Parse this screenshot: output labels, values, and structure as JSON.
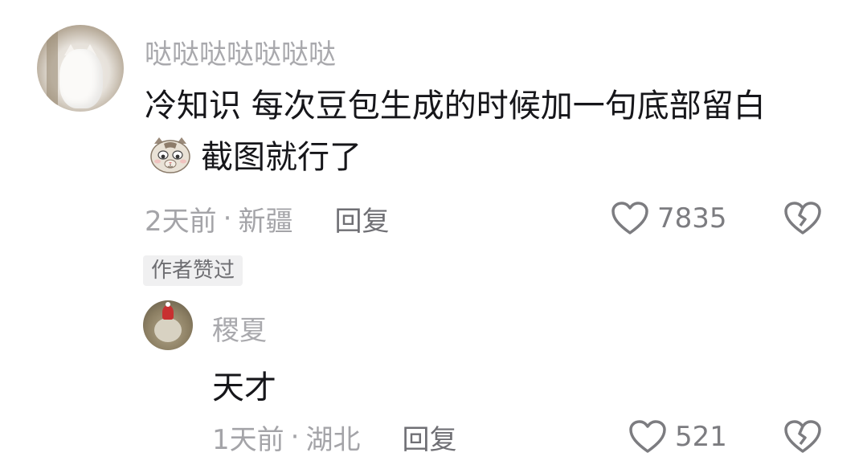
{
  "comment": {
    "username": "哒哒哒哒哒哒哒",
    "text_before_emoji": "冷知识 每次豆包生成的时候加一句底部留白",
    "emoji": "cat-face-emoji",
    "text_after_emoji": "截图就行了",
    "time": "2天前",
    "separator": "·",
    "location": "新疆",
    "reply_label": "回复",
    "like_count": "7835",
    "author_liked_badge": "作者赞过"
  },
  "reply": {
    "username": "稷夏",
    "text": "天才",
    "time": "1天前",
    "separator": "·",
    "location": "湖北",
    "reply_label": "回复",
    "like_count": "521"
  },
  "colors": {
    "primary_text": "#16161a",
    "secondary_text": "#a4a4a8",
    "badge_bg": "#f0f0f1"
  }
}
